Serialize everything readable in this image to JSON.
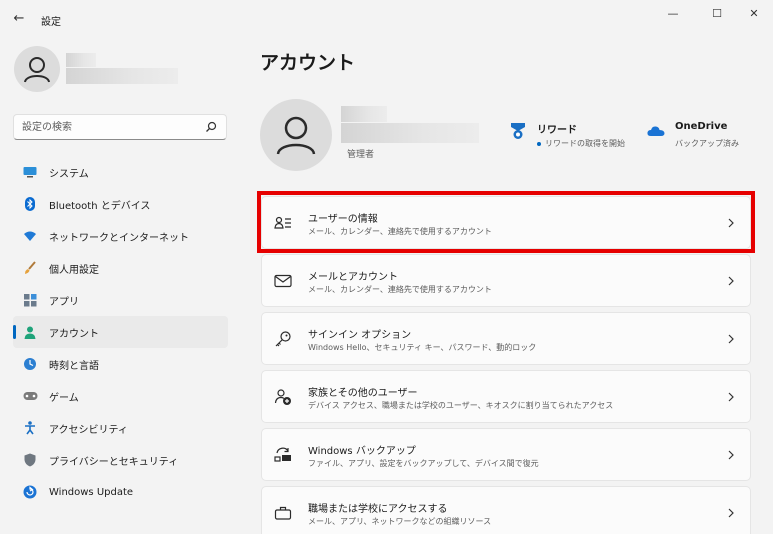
{
  "window": {
    "title": "設定",
    "back_glyph": "←",
    "minimize_glyph": "—",
    "maximize_glyph": "☐",
    "close_glyph": "✕"
  },
  "search": {
    "placeholder": "設定の検索",
    "value": ""
  },
  "sidebar": {
    "items": [
      {
        "label": "システム",
        "icon": "system-icon"
      },
      {
        "label": "Bluetooth とデバイス",
        "icon": "bluetooth-icon"
      },
      {
        "label": "ネットワークとインターネット",
        "icon": "network-icon"
      },
      {
        "label": "個人用設定",
        "icon": "brush-icon"
      },
      {
        "label": "アプリ",
        "icon": "apps-icon"
      },
      {
        "label": "アカウント",
        "icon": "account-icon",
        "active": true
      },
      {
        "label": "時刻と言語",
        "icon": "time-language-icon"
      },
      {
        "label": "ゲーム",
        "icon": "gaming-icon"
      },
      {
        "label": "アクセシビリティ",
        "icon": "accessibility-icon"
      },
      {
        "label": "プライバシーとセキュリティ",
        "icon": "shield-icon"
      },
      {
        "label": "Windows Update",
        "icon": "update-icon"
      }
    ]
  },
  "main": {
    "title": "アカウント",
    "profile": {
      "role": "管理者"
    },
    "services": [
      {
        "title": "リワード",
        "subtitle": "リワードの取得を開始",
        "icon": "rewards-icon"
      },
      {
        "title": "OneDrive",
        "subtitle": "バックアップ済み",
        "icon": "onedrive-icon"
      }
    ],
    "cards": [
      {
        "title": "ユーザーの情報",
        "subtitle": "メール、カレンダー、連絡先で使用するアカウント",
        "icon": "user-info-icon"
      },
      {
        "title": "メールとアカウント",
        "subtitle": "メール、カレンダー、連絡先で使用するアカウント",
        "icon": "mail-icon"
      },
      {
        "title": "サインイン オプション",
        "subtitle": "Windows Hello、セキュリティ キー、パスワード、動的ロック",
        "icon": "key-icon"
      },
      {
        "title": "家族とその他のユーザー",
        "subtitle": "デバイス アクセス、職場または学校のユーザー、キオスクに割り当てられたアクセス",
        "icon": "family-icon"
      },
      {
        "title": "Windows バックアップ",
        "subtitle": "ファイル、アプリ、設定をバックアップして、デバイス間で復元",
        "icon": "backup-icon"
      },
      {
        "title": "職場または学校にアクセスする",
        "subtitle": "メール、アプリ、ネットワークなどの組織リソース",
        "icon": "briefcase-icon"
      }
    ]
  },
  "colors": {
    "accent": "#0067c0",
    "highlight": "#e60000",
    "background": "#f3f3f3"
  }
}
